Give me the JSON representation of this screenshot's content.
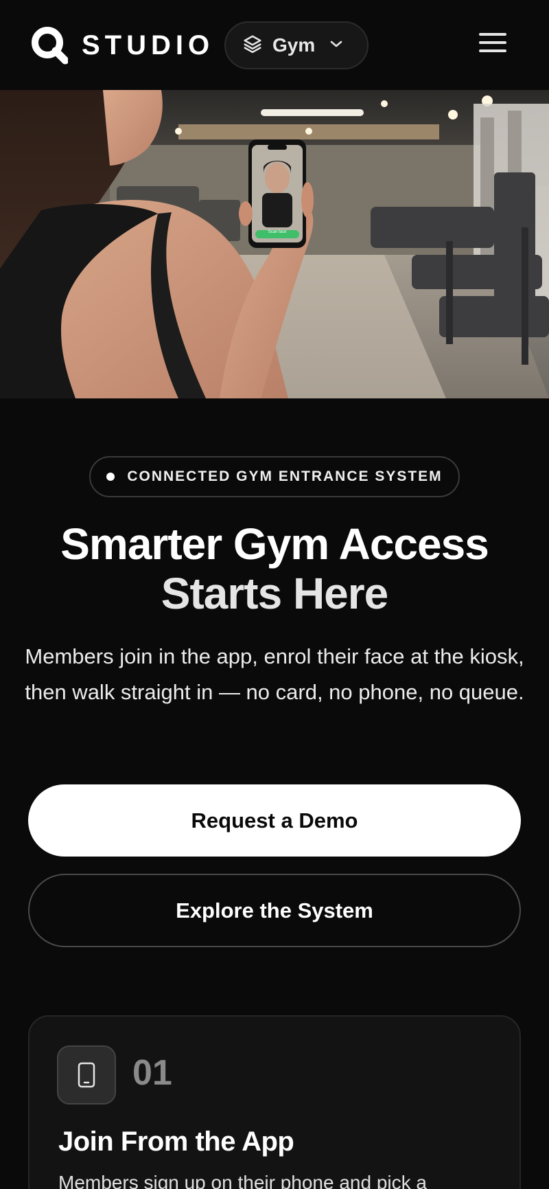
{
  "header": {
    "logo_text": "STUDIO",
    "switcher_label": "Gym"
  },
  "hero": {
    "phone_button_text": "Scan face"
  },
  "badge": {
    "text": "CONNECTED GYM ENTRANCE SYSTEM"
  },
  "headline": {
    "line1": "Smarter Gym Access",
    "line2": "Starts Here"
  },
  "description": "Members join in the app, enrol their face at the kiosk, then walk straight in — no card, no phone, no queue.",
  "actions": {
    "primary_label": "Request a Demo",
    "secondary_label": "Explore the System"
  },
  "steps": [
    {
      "number": "01",
      "title": "Join From the App",
      "text": "Members sign up on their phone and pick a",
      "icon": "smartphone-icon"
    }
  ],
  "colors": {
    "background": "#0a0a0a",
    "primary_button": "#ffffff",
    "accent_green": "#3fbf6a"
  }
}
